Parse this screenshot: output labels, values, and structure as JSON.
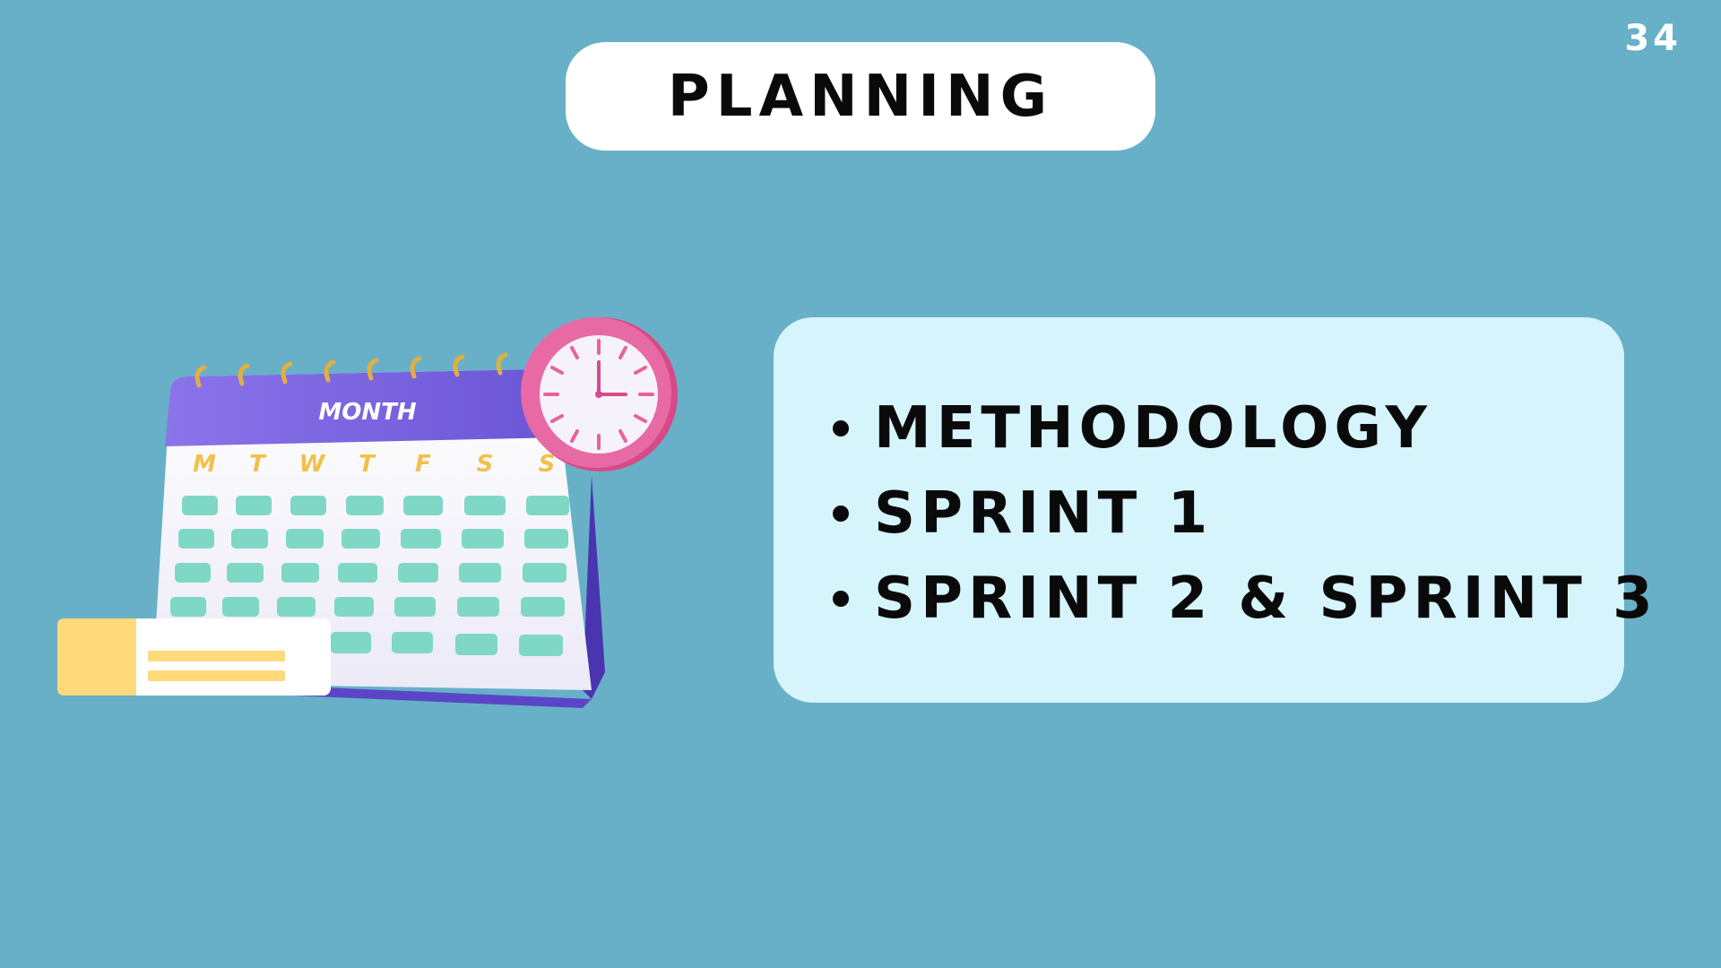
{
  "slide": {
    "page_number": "34",
    "title": "PLANNING"
  },
  "content": {
    "items": [
      "METHODOLOGY",
      "SPRINT 1",
      "SPRINT 2 & SPRINT 3"
    ]
  },
  "illustration": {
    "calendar_header": "MONTH",
    "weekdays": [
      "M",
      "T",
      "W",
      "T",
      "F",
      "S",
      "S"
    ]
  },
  "colors": {
    "background": "#68b0c8",
    "card": "#d6f4fb",
    "calendar_purple": "#7b63e0",
    "day_cells": "#7fd8c6",
    "clock_pink": "#e85a9a",
    "note_yellow": "#ffd97a"
  }
}
